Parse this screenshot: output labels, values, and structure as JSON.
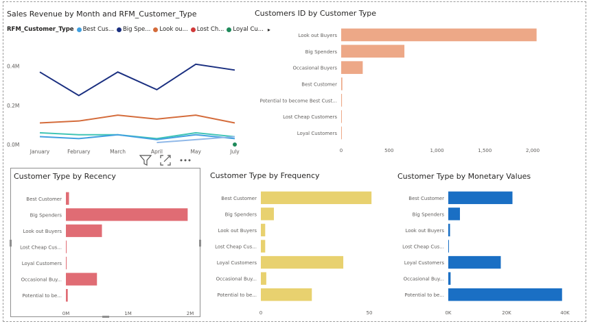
{
  "line_visual": {
    "title": "Sales Revenue by Month and RFM_Customer_Type",
    "legend_title": "RFM_Customer_Type",
    "legend": [
      {
        "label": "Best Cus...",
        "color": "#41a0e0"
      },
      {
        "label": "Big Spe...",
        "color": "#1a2f80"
      },
      {
        "label": "Look ou...",
        "color": "#d46b3a"
      },
      {
        "label": "Lost Ch...",
        "color": "#d13a3a"
      },
      {
        "label": "Loyal Cu...",
        "color": "#1f8a5b"
      }
    ],
    "legend_more": "▸",
    "chart_data": {
      "type": "line",
      "x": [
        "January",
        "February",
        "March",
        "April",
        "May",
        "July"
      ],
      "y_ticks": [
        "0.4M",
        "0.2M",
        "0.0M"
      ],
      "ylim": [
        0,
        0.5
      ],
      "series": [
        {
          "color": "#1a2f80",
          "values": [
            0.37,
            0.25,
            0.37,
            0.28,
            0.41,
            0.38
          ]
        },
        {
          "color": "#d46b3a",
          "values": [
            0.11,
            0.12,
            0.15,
            0.13,
            0.15,
            0.11
          ]
        },
        {
          "color": "#3fc4b5",
          "values": [
            0.06,
            0.05,
            0.05,
            0.03,
            0.06,
            0.04
          ]
        },
        {
          "color": "#41a0e0",
          "values": [
            0.04,
            0.03,
            0.05,
            0.025,
            0.05,
            0.03
          ]
        },
        {
          "color": "#8fb8e8",
          "values": [
            null,
            null,
            null,
            0.01,
            0.025,
            0.04
          ]
        },
        {
          "color": "#1f8a5b",
          "values": [
            null,
            null,
            null,
            null,
            null,
            0.0
          ]
        }
      ]
    }
  },
  "customers_visual": {
    "title": "Customers ID by Customer Type",
    "chart_data": {
      "type": "bar",
      "color": "#eda887",
      "categories": [
        "Look out Buyers",
        "Big Spenders",
        "Occasional Buyers",
        "Best Customer",
        "Potential to become Best Cust...",
        "Lost Cheap Customers",
        "Loyal Customers"
      ],
      "values": [
        2040,
        660,
        225,
        12,
        8,
        6,
        3
      ],
      "xlim": [
        0,
        2150
      ],
      "ticks": [
        0,
        500,
        1000,
        1500,
        2000
      ],
      "tick_labels": [
        "0",
        "500",
        "1,000",
        "1,500",
        "2,000"
      ]
    }
  },
  "recency_visual": {
    "title": "Customer Type by Recency",
    "chart_data": {
      "type": "bar",
      "color": "#e06c74",
      "categories": [
        "Best Customer",
        "Big Spenders",
        "Look out Buyers",
        "Lost Cheap Cus...",
        "Loyal Customers",
        "Occasional Buy...",
        "Potential to be..."
      ],
      "values": [
        0.05,
        1.96,
        0.58,
        0.005,
        0.005,
        0.5,
        0.03
      ],
      "xlim": [
        0,
        2.0
      ],
      "ticks": [
        0,
        1,
        2
      ],
      "tick_labels": [
        "0M",
        "1M",
        "2M"
      ]
    },
    "toolbar": {
      "filter_icon": "filter-icon",
      "focus_icon": "focus-mode-icon",
      "more_icon": "more-options-icon"
    }
  },
  "frequency_visual": {
    "title": "Customer Type by Frequency",
    "chart_data": {
      "type": "bar",
      "color": "#e8d16f",
      "categories": [
        "Best Customer",
        "Big Spenders",
        "Look out Buyers",
        "Lost Cheap Cus...",
        "Loyal Customers",
        "Occasional Buy...",
        "Potential to be..."
      ],
      "values": [
        51,
        6,
        2,
        2,
        38,
        2.5,
        23.5
      ],
      "xlim": [
        0,
        50
      ],
      "ticks": [
        0,
        50
      ],
      "tick_labels": [
        "0",
        "50"
      ]
    }
  },
  "monetary_visual": {
    "title": "Customer Type by Monetary Values",
    "chart_data": {
      "type": "bar",
      "color": "#1a6fc4",
      "categories": [
        "Best Customer",
        "Big Spenders",
        "Look out Buyers",
        "Lost Cheap Cus...",
        "Loyal Customers",
        "Occasional Buy...",
        "Potential to be..."
      ],
      "values": [
        22000,
        4000,
        600,
        200,
        18000,
        800,
        39000
      ],
      "xlim": [
        0,
        40000
      ],
      "ticks": [
        0,
        20000,
        40000
      ],
      "tick_labels": [
        "0K",
        "20K",
        "40K"
      ]
    }
  }
}
